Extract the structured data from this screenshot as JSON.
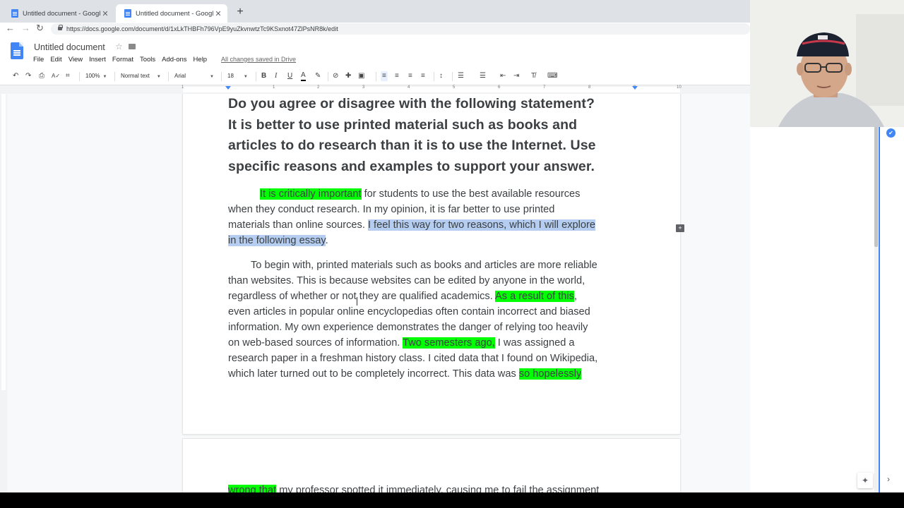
{
  "browser": {
    "tabs": [
      {
        "title": "Untitled document - Google Doc",
        "active": false
      },
      {
        "title": "Untitled document - Google Doc",
        "active": true
      }
    ],
    "url": "https://docs.google.com/document/d/1xLkTHBFh796VpE9yuZkvnwtzTc9KSxnot47ZlPsNR8k/edit"
  },
  "docs": {
    "title": "Untitled document",
    "menu": [
      "File",
      "Edit",
      "View",
      "Insert",
      "Format",
      "Tools",
      "Add-ons",
      "Help"
    ],
    "save_status": "All changes saved in Drive",
    "toolbar": {
      "zoom": "100%",
      "style": "Normal text",
      "font": "Arial",
      "size": "18"
    },
    "ruler_numbers": [
      "1",
      "1",
      "2",
      "3",
      "4",
      "5",
      "6",
      "7",
      "8",
      "9",
      "10"
    ]
  },
  "document": {
    "heading_lines": [
      "Do you agree or disagree with the following statement?",
      "It is better to use printed material such as books and",
      "articles to do research than it is to use the Internet. Use",
      "specific reasons and examples to support your answer."
    ],
    "para1": {
      "highlight_1": "It is critically important",
      "line1_rest": " for students to use the best available resources",
      "line2": "when they conduct research.  In my opinion, it is far better to use printed",
      "line3_plain": "materials than online sources. ",
      "line3_selected": "I feel this way for two reasons, which I will explore",
      "line4_selected": "in the following essay",
      "line4_end": "."
    },
    "para2": {
      "line1": "To begin with, printed materials such as books and articles are more reliable",
      "line2": "than websites.  This is because websites can be edited by anyone in the world,",
      "line3_plain": "regardless of whether or not they are qualified academics.  ",
      "line3_highlight": "As a result of this",
      "line3_end": ",",
      "line4": "even articles in popular online encyclopedias often contain incorrect and biased",
      "line5": "information. My own experience demonstrates the danger of relying too heavily",
      "line6_plain": "on web-based sources of information.  ",
      "line6_highlight": "Two semesters ago,",
      "line6_end": " I was assigned a",
      "line7": "research paper in a freshman history class. I cited data that I found on Wikipedia,",
      "line8_plain": "which later turned out to be completely incorrect. This data was ",
      "line8_highlight": "so hopelessly"
    },
    "page2": {
      "line1_highlight": "wrong that",
      "line1_rest": " my professor spotted it immediately, causing me to fail the assignment"
    }
  },
  "icons": {
    "undo": "↶",
    "redo": "↷",
    "print": "⎙",
    "spellcheck": "A✓",
    "paint": "⌗",
    "bold": "B",
    "italic": "I",
    "underline": "U",
    "text_color": "A",
    "highlight": "✎",
    "link": "⊘",
    "comment": "✚",
    "image": "▣",
    "align_left": "≡",
    "align_center": "≡",
    "align_right": "≡",
    "justify": "≡",
    "line_spacing": "↕",
    "numbered_list": "☰",
    "bulleted_list": "☰",
    "indent_dec": "⇤",
    "indent_inc": "⇥",
    "clear_format": "T̸",
    "input_tools": "⌨",
    "check": "✔",
    "explore": "✦",
    "chevron_right": "›",
    "add_comment": "+"
  },
  "colors": {
    "highlight": "#00ff00",
    "selection": "#b4cdf0",
    "accent": "#4285f4"
  }
}
